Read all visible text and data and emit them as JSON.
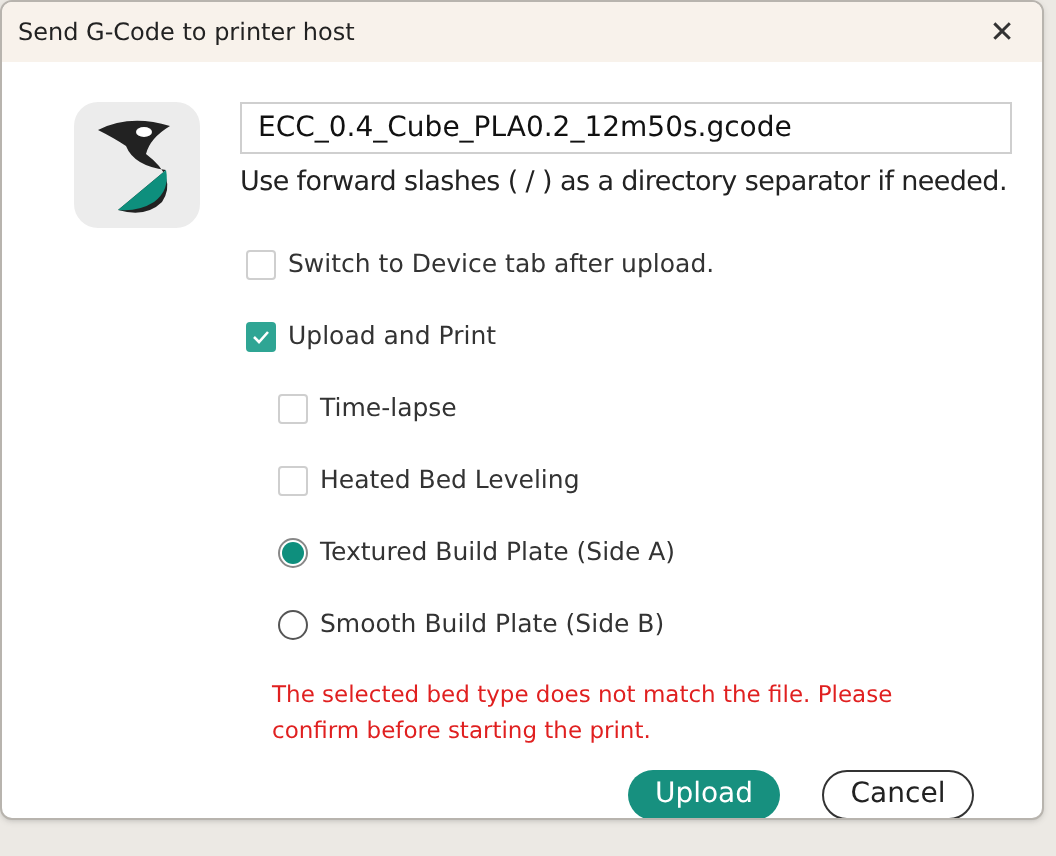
{
  "window": {
    "title": "Send G-Code to printer host",
    "close": "✕"
  },
  "filename": {
    "value": "ECC_0.4_Cube_PLA0.2_12m50s.gcode"
  },
  "hint": "Use forward slashes ( / ) as a directory separator if needed.",
  "options": [
    {
      "kind": "checkbox",
      "label": "Switch to Device tab after upload.",
      "checked": false
    },
    {
      "kind": "checkbox",
      "label": "Upload and Print",
      "checked": true,
      "children": [
        {
          "kind": "checkbox",
          "label": "Time-lapse",
          "checked": false
        },
        {
          "kind": "checkbox",
          "label": "Heated Bed Leveling",
          "checked": false
        },
        {
          "kind": "radio",
          "label": "Textured Build Plate (Side A)",
          "selected": true
        },
        {
          "kind": "radio",
          "label": "Smooth Build Plate (Side B)",
          "selected": false
        }
      ]
    }
  ],
  "warning": "The selected bed type does not match the file. Please confirm before starting the print.",
  "buttons": [
    {
      "kind": "primary",
      "label": "Upload"
    },
    {
      "kind": "secondary",
      "label": "Cancel"
    }
  ]
}
